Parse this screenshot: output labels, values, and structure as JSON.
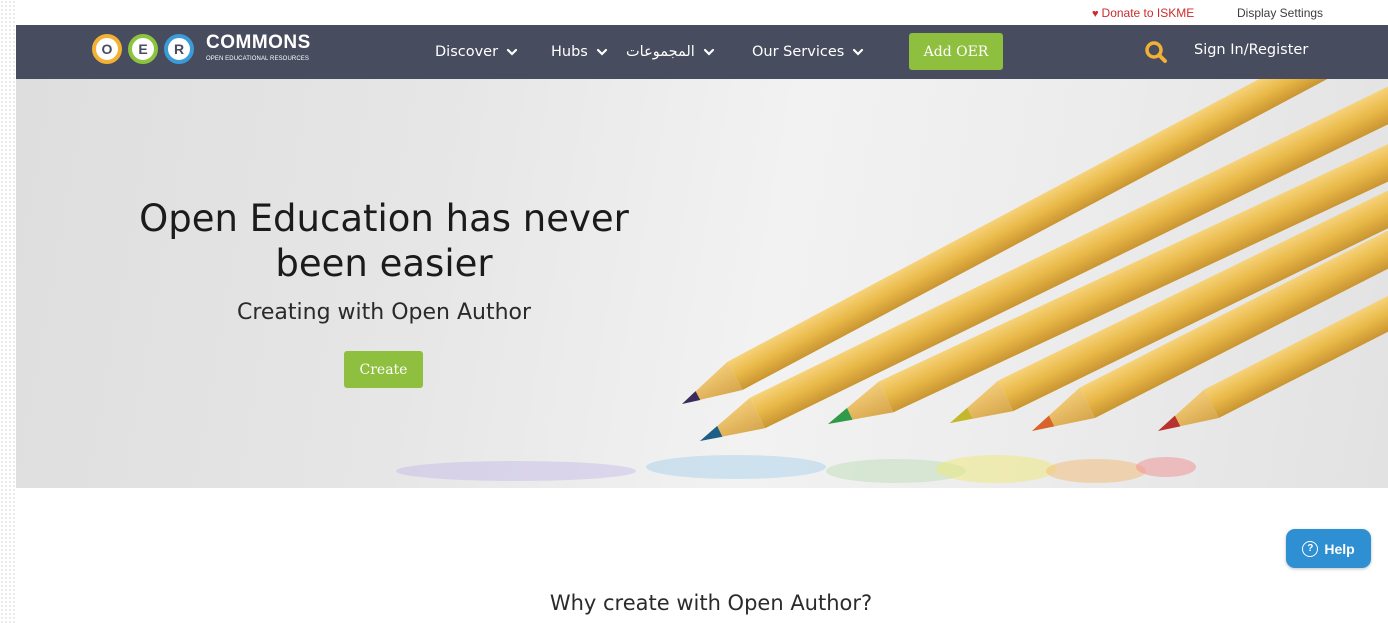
{
  "utility": {
    "donate_label": "Donate to ISKME",
    "display_settings_label": "Display Settings"
  },
  "logo": {
    "letters": [
      "O",
      "E",
      "R"
    ],
    "title": "COMMONS",
    "subtitle": "OPEN EDUCATIONAL RESOURCES"
  },
  "nav": {
    "items": [
      {
        "label": "Discover"
      },
      {
        "label": "Hubs"
      },
      {
        "label": "المجموعات"
      },
      {
        "label": "Our Services"
      }
    ],
    "add_oer_label": "Add OER",
    "sign_in_label": "Sign In/Register"
  },
  "hero": {
    "title": "Open Education has never been easier",
    "subtitle": "Creating with Open Author",
    "create_label": "Create"
  },
  "help": {
    "label": "Help"
  },
  "section": {
    "heading": "Why create with Open Author?"
  },
  "colors": {
    "navbar": "#474c5e",
    "accent_green": "#8fbf3f",
    "help_blue": "#2e8fd3",
    "search_icon": "#f2b134",
    "donate_red": "#cc2b2b"
  },
  "icons": {
    "donate": "heart-icon",
    "search": "search-icon",
    "dropdown": "chevron-down-icon",
    "help": "question-circle-icon"
  }
}
